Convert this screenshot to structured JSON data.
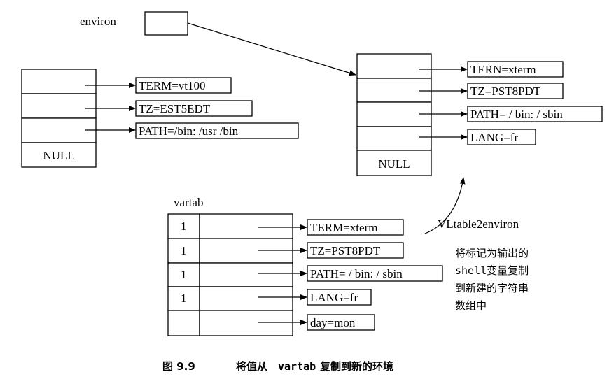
{
  "environ": {
    "label": "environ"
  },
  "old_env": {
    "strings": [
      "TERM=vt100",
      "TZ=EST5EDT",
      "PATH=/bin: /usr /bin"
    ],
    "null_label": "NULL"
  },
  "new_env": {
    "strings": [
      "TERN=xterm",
      "TZ=PST8PDT",
      "PATH= / bin: / sbin",
      "LANG=fr"
    ],
    "null_label": "NULL"
  },
  "vartab": {
    "label": "vartab",
    "rows": [
      {
        "flag": "1",
        "string": "TERM=xterm"
      },
      {
        "flag": "1",
        "string": "TZ=PST8PDT"
      },
      {
        "flag": "1",
        "string": "PATH= / bin: / sbin"
      },
      {
        "flag": "1",
        "string": "LANG=fr"
      },
      {
        "flag": "",
        "string": "day=mon"
      }
    ]
  },
  "annotation": {
    "function": "VLtable2environ",
    "lines": [
      "将标记为输出的",
      "shell变量复制",
      "到新建的字符串",
      "数组中"
    ]
  },
  "caption": {
    "number": "图 9.9",
    "part1": "将值从",
    "code": "vartab",
    "part2": "复制到新的环境"
  }
}
